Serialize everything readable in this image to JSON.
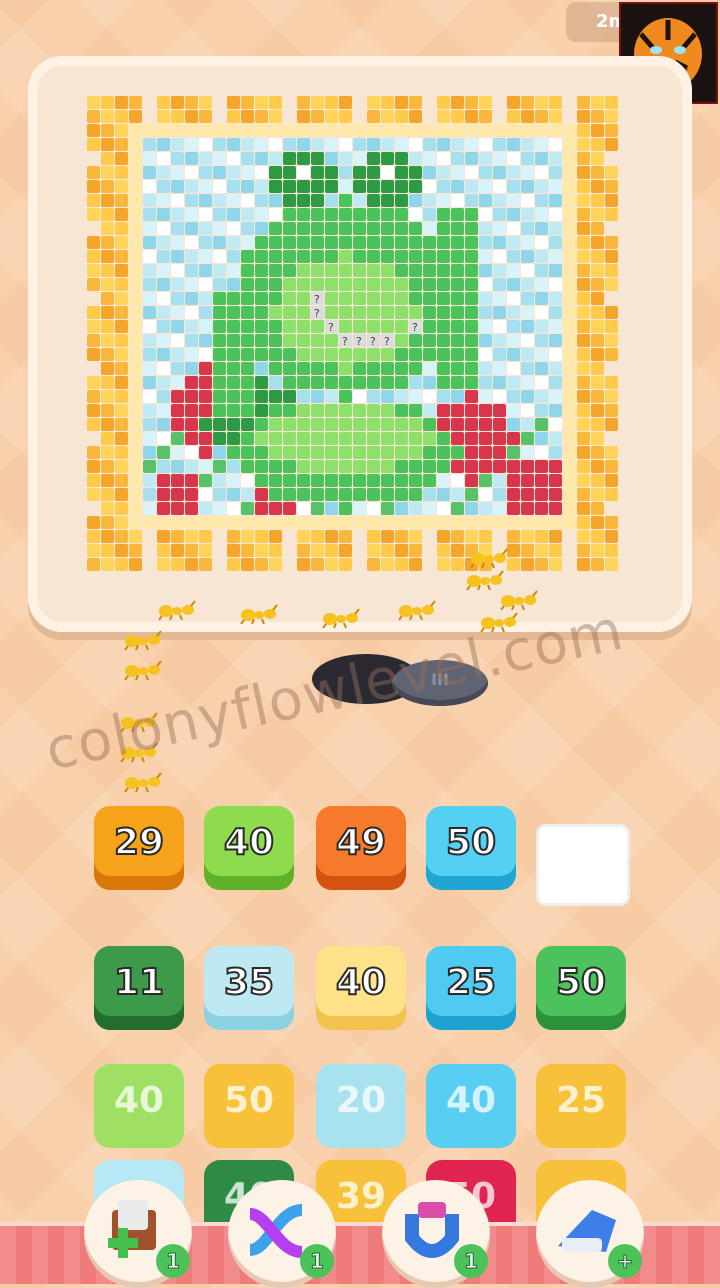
{
  "header": {
    "timer_text": "2m"
  },
  "puzzle": {
    "hidden_cells": [
      "?",
      "?",
      "?",
      "?",
      "?",
      "?",
      "?",
      "?"
    ]
  },
  "slots": [
    {
      "value": "29",
      "color": "#f6a21b",
      "dark": "#d9780a"
    },
    {
      "value": "40",
      "color": "#8fdb4e",
      "dark": "#5fb12a"
    },
    {
      "value": "49",
      "color": "#f57a2c",
      "dark": "#d4530f"
    },
    {
      "value": "50",
      "color": "#53d0f2",
      "dark": "#21a6d3"
    },
    {
      "value": "",
      "color": "#ffffff",
      "dark": "#e6e6e6"
    }
  ],
  "grid": {
    "row1": [
      {
        "value": "11",
        "color": "#3d9a4a",
        "dark": "#236e2f"
      },
      {
        "value": "35",
        "color": "#bde9f2",
        "dark": "#8dd2e2"
      },
      {
        "value": "40",
        "color": "#ffe28a",
        "dark": "#f2c24c"
      },
      {
        "value": "25",
        "color": "#4fcaf0",
        "dark": "#1ea2cf"
      },
      {
        "value": "50",
        "color": "#4bc25b",
        "dark": "#2a9338"
      }
    ],
    "row2": [
      {
        "value": "40",
        "color": "#9ee063"
      },
      {
        "value": "50",
        "color": "#f8c13a"
      },
      {
        "value": "20",
        "color": "#a9e2ef"
      },
      {
        "value": "40",
        "color": "#58cff2"
      },
      {
        "value": "25",
        "color": "#f8c13a"
      }
    ],
    "row3": [
      {
        "value": "",
        "color": "#b6e9f5"
      },
      {
        "value": "40",
        "color": "#2f8a45"
      },
      {
        "value": "39",
        "color": "#f8c13a"
      },
      {
        "value": "50",
        "color": "#e0244f"
      },
      {
        "value": "",
        "color": "#f8c13a"
      }
    ]
  },
  "watermark": "colonyflowlevel.com",
  "boosters": [
    {
      "name": "add-slot",
      "count": "1"
    },
    {
      "name": "shuffle",
      "count": "1"
    },
    {
      "name": "magnet",
      "count": "1"
    },
    {
      "name": "vacuum",
      "count": "+"
    }
  ],
  "colors": {
    "frame": "#f9b83b",
    "frog": "#4cc35a",
    "sky": "#bfeaf4",
    "flower": "#d9364d"
  }
}
